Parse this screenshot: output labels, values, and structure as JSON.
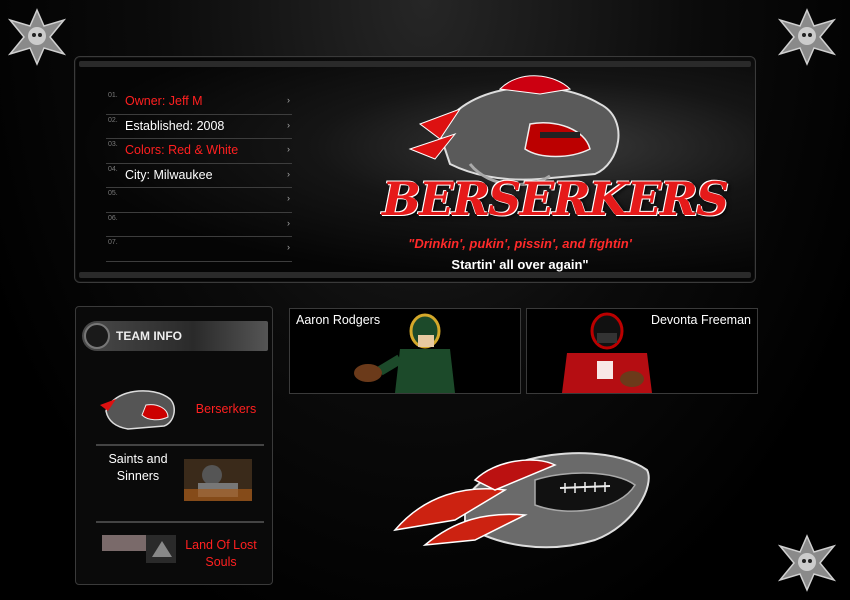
{
  "team_info_list": [
    {
      "num": "01.",
      "text": "Owner: Jeff M",
      "highlight": true
    },
    {
      "num": "02.",
      "text": "Established: 2008",
      "highlight": false
    },
    {
      "num": "03.",
      "text": "Colors: Red & White",
      "highlight": true
    },
    {
      "num": "04.",
      "text": "City: Milwaukee",
      "highlight": false
    },
    {
      "num": "05.",
      "text": "",
      "highlight": false
    },
    {
      "num": "06.",
      "text": "",
      "highlight": false
    },
    {
      "num": "07.",
      "text": "",
      "highlight": false
    }
  ],
  "list_arrow": "›",
  "brand": {
    "name": "BERSERKERS",
    "slogan_1": "\"Drinkin', pukin', pissin', and fightin'",
    "slogan_2": "Startin' all over again\""
  },
  "team_panel": {
    "header": "TEAM INFO",
    "teams": [
      {
        "name": "Berserkers"
      },
      {
        "name": "Saints and Sinners"
      },
      {
        "name": "Land Of Lost Souls"
      }
    ]
  },
  "players": [
    {
      "name": "Aaron Rodgers"
    },
    {
      "name": "Devonta Freeman"
    }
  ],
  "colors": {
    "accent": "#e61a1a",
    "text": "#ffffff",
    "panel_border": "#3a3a3a"
  }
}
